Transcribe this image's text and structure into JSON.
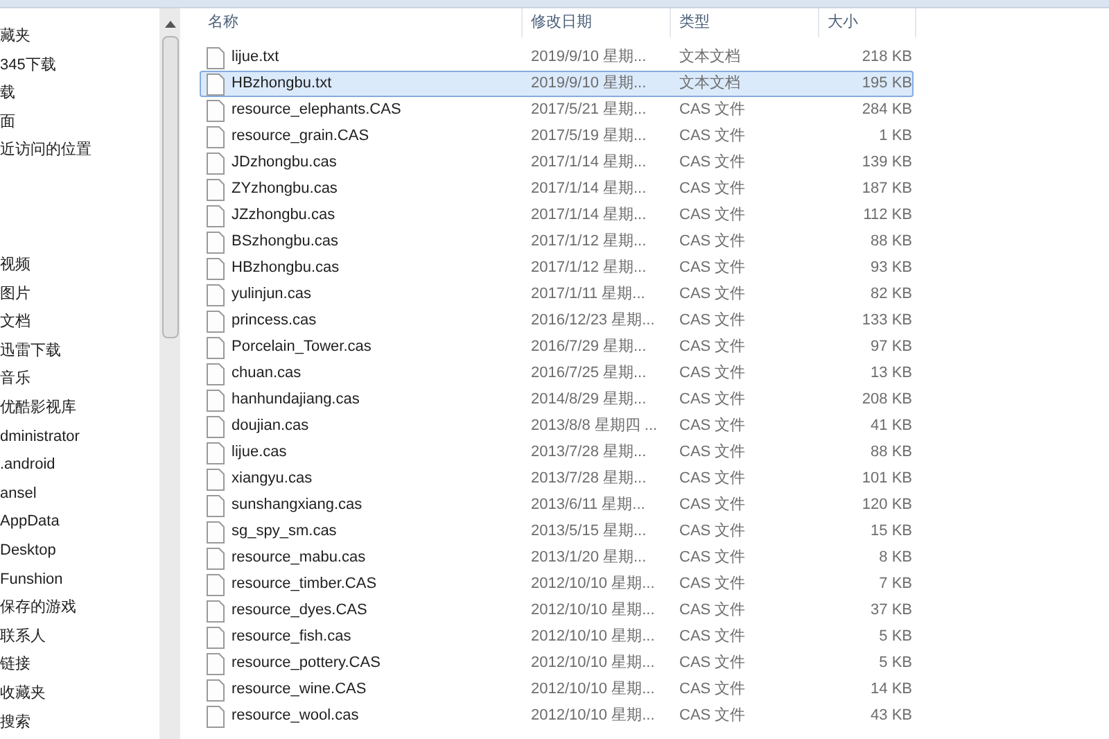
{
  "sidebar": {
    "groups": [
      {
        "items": [
          {
            "label": "藏夹"
          },
          {
            "label": "345下载"
          },
          {
            "label": "载"
          },
          {
            "label": "面"
          },
          {
            "label": "近访问的位置"
          }
        ]
      },
      {
        "items": [
          {
            "label": "视频"
          },
          {
            "label": "图片"
          },
          {
            "label": "文档"
          },
          {
            "label": "迅雷下载"
          },
          {
            "label": "音乐"
          },
          {
            "label": "优酷影视库"
          },
          {
            "label": "dministrator"
          },
          {
            "label": ".android"
          },
          {
            "label": "ansel"
          },
          {
            "label": "AppData"
          },
          {
            "label": "Desktop"
          },
          {
            "label": "Funshion"
          },
          {
            "label": "保存的游戏"
          },
          {
            "label": "联系人"
          },
          {
            "label": "链接"
          },
          {
            "label": "收藏夹"
          },
          {
            "label": "搜索"
          }
        ]
      }
    ]
  },
  "table": {
    "columns": [
      "名称",
      "修改日期",
      "类型",
      "大小"
    ],
    "rows": [
      {
        "name": "lijue.txt",
        "date": "2019/9/10 星期...",
        "type": "文本文档",
        "size": "218 KB",
        "selected": false
      },
      {
        "name": "HBzhongbu.txt",
        "date": "2019/9/10 星期...",
        "type": "文本文档",
        "size": "195 KB",
        "selected": true
      },
      {
        "name": "resource_elephants.CAS",
        "date": "2017/5/21 星期...",
        "type": "CAS 文件",
        "size": "284 KB",
        "selected": false
      },
      {
        "name": "resource_grain.CAS",
        "date": "2017/5/19 星期...",
        "type": "CAS 文件",
        "size": "1 KB",
        "selected": false
      },
      {
        "name": "JDzhongbu.cas",
        "date": "2017/1/14 星期...",
        "type": "CAS 文件",
        "size": "139 KB",
        "selected": false
      },
      {
        "name": "ZYzhongbu.cas",
        "date": "2017/1/14 星期...",
        "type": "CAS 文件",
        "size": "187 KB",
        "selected": false
      },
      {
        "name": "JZzhongbu.cas",
        "date": "2017/1/14 星期...",
        "type": "CAS 文件",
        "size": "112 KB",
        "selected": false
      },
      {
        "name": "BSzhongbu.cas",
        "date": "2017/1/12 星期...",
        "type": "CAS 文件",
        "size": "88 KB",
        "selected": false
      },
      {
        "name": "HBzhongbu.cas",
        "date": "2017/1/12 星期...",
        "type": "CAS 文件",
        "size": "93 KB",
        "selected": false
      },
      {
        "name": "yulinjun.cas",
        "date": "2017/1/11 星期...",
        "type": "CAS 文件",
        "size": "82 KB",
        "selected": false
      },
      {
        "name": "princess.cas",
        "date": "2016/12/23 星期...",
        "type": "CAS 文件",
        "size": "133 KB",
        "selected": false
      },
      {
        "name": "Porcelain_Tower.cas",
        "date": "2016/7/29 星期...",
        "type": "CAS 文件",
        "size": "97 KB",
        "selected": false
      },
      {
        "name": "chuan.cas",
        "date": "2016/7/25 星期...",
        "type": "CAS 文件",
        "size": "13 KB",
        "selected": false
      },
      {
        "name": "hanhundajiang.cas",
        "date": "2014/8/29 星期...",
        "type": "CAS 文件",
        "size": "208 KB",
        "selected": false
      },
      {
        "name": "doujian.cas",
        "date": "2013/8/8 星期四 ...",
        "type": "CAS 文件",
        "size": "41 KB",
        "selected": false
      },
      {
        "name": "lijue.cas",
        "date": "2013/7/28 星期...",
        "type": "CAS 文件",
        "size": "88 KB",
        "selected": false
      },
      {
        "name": "xiangyu.cas",
        "date": "2013/7/28 星期...",
        "type": "CAS 文件",
        "size": "101 KB",
        "selected": false
      },
      {
        "name": "sunshangxiang.cas",
        "date": "2013/6/11 星期...",
        "type": "CAS 文件",
        "size": "120 KB",
        "selected": false
      },
      {
        "name": "sg_spy_sm.cas",
        "date": "2013/5/15 星期...",
        "type": "CAS 文件",
        "size": "15 KB",
        "selected": false
      },
      {
        "name": "resource_mabu.cas",
        "date": "2013/1/20 星期...",
        "type": "CAS 文件",
        "size": "8 KB",
        "selected": false
      },
      {
        "name": "resource_timber.CAS",
        "date": "2012/10/10 星期...",
        "type": "CAS 文件",
        "size": "7 KB",
        "selected": false
      },
      {
        "name": "resource_dyes.CAS",
        "date": "2012/10/10 星期...",
        "type": "CAS 文件",
        "size": "37 KB",
        "selected": false
      },
      {
        "name": "resource_fish.cas",
        "date": "2012/10/10 星期...",
        "type": "CAS 文件",
        "size": "5 KB",
        "selected": false
      },
      {
        "name": "resource_pottery.CAS",
        "date": "2012/10/10 星期...",
        "type": "CAS 文件",
        "size": "5 KB",
        "selected": false
      },
      {
        "name": "resource_wine.CAS",
        "date": "2012/10/10 星期...",
        "type": "CAS 文件",
        "size": "14 KB",
        "selected": false
      },
      {
        "name": "resource_wool.cas",
        "date": "2012/10/10 星期...",
        "type": "CAS 文件",
        "size": "43 KB",
        "selected": false
      }
    ]
  }
}
